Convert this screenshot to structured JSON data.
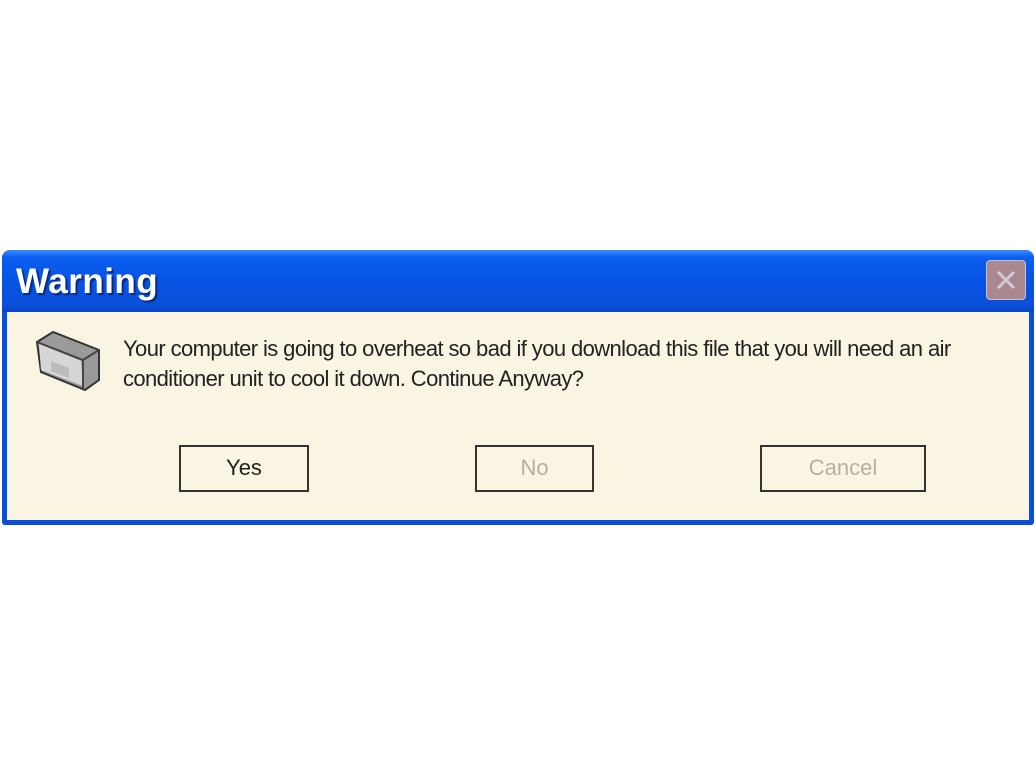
{
  "dialog": {
    "title": "Warning",
    "close_icon": "close-icon",
    "icon": "air-conditioner-icon",
    "message": "Your computer is going to overheat so bad if you download this file that you will need an air conditioner unit to cool it down. Continue Anyway?",
    "buttons": [
      {
        "label": "Yes",
        "enabled": true
      },
      {
        "label": "No",
        "enabled": false
      },
      {
        "label": "Cancel",
        "enabled": false
      }
    ]
  },
  "colors": {
    "titlebar": "#0a4fd8",
    "body": "#f9f5e2"
  }
}
